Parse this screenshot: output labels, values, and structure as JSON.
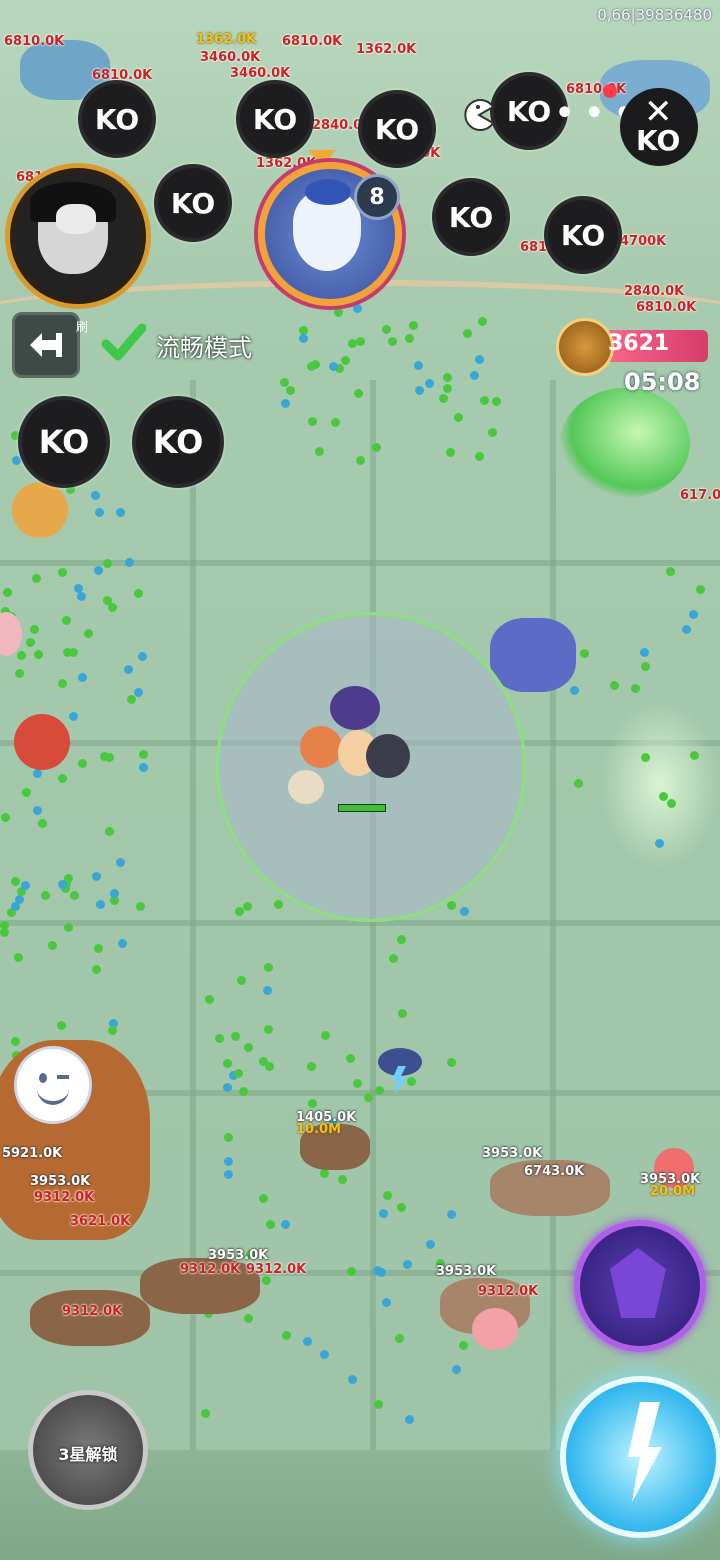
{
  "status": {
    "id_text": "0,66|39836480"
  },
  "top_bar": {
    "ko_label": "KO",
    "more_label": "• • •",
    "close_label": "✕",
    "close_ko": "KO"
  },
  "boss": {
    "level_badge": "8"
  },
  "controls": {
    "back_sub": "刷",
    "smooth_mode_label": "流畅模式",
    "score": "3621",
    "timer": "05:08"
  },
  "unlock": {
    "label": "3星解锁"
  },
  "damage_numbers": [
    "6810.0K",
    "1362.0K",
    "6810.0K",
    "6810.0K",
    "1362.0K",
    "3460.0K",
    "3460.0K",
    "6810.0K",
    "6810.0K",
    "2840.0K",
    "1362.0K",
    "6810.0K",
    "1362.0K",
    "4700K",
    "2840.0K",
    "6810.0K",
    "617.0K",
    "1405.0K",
    "10.0M",
    "3953.0K",
    "6743.0K",
    "3953.0K",
    "20.0M",
    "5921.0K",
    "3953.0K",
    "9312.0K",
    "3953.0K",
    "9312.0K",
    "9312.0K",
    "3953.0K",
    "9312.0K",
    "9312.0K",
    "3621.0K"
  ],
  "colors": {
    "accent_score": "#d63d6a",
    "range_border": "#8ee07c",
    "ko_bg": "#1d1d1f"
  },
  "icons": [
    "back-arrow-icon",
    "check-icon",
    "sword-icon",
    "emote-icon",
    "close-icon",
    "pacman-icon",
    "lightning-skill-icon",
    "demon-skill-icon",
    "storm-cloud-icon"
  ]
}
